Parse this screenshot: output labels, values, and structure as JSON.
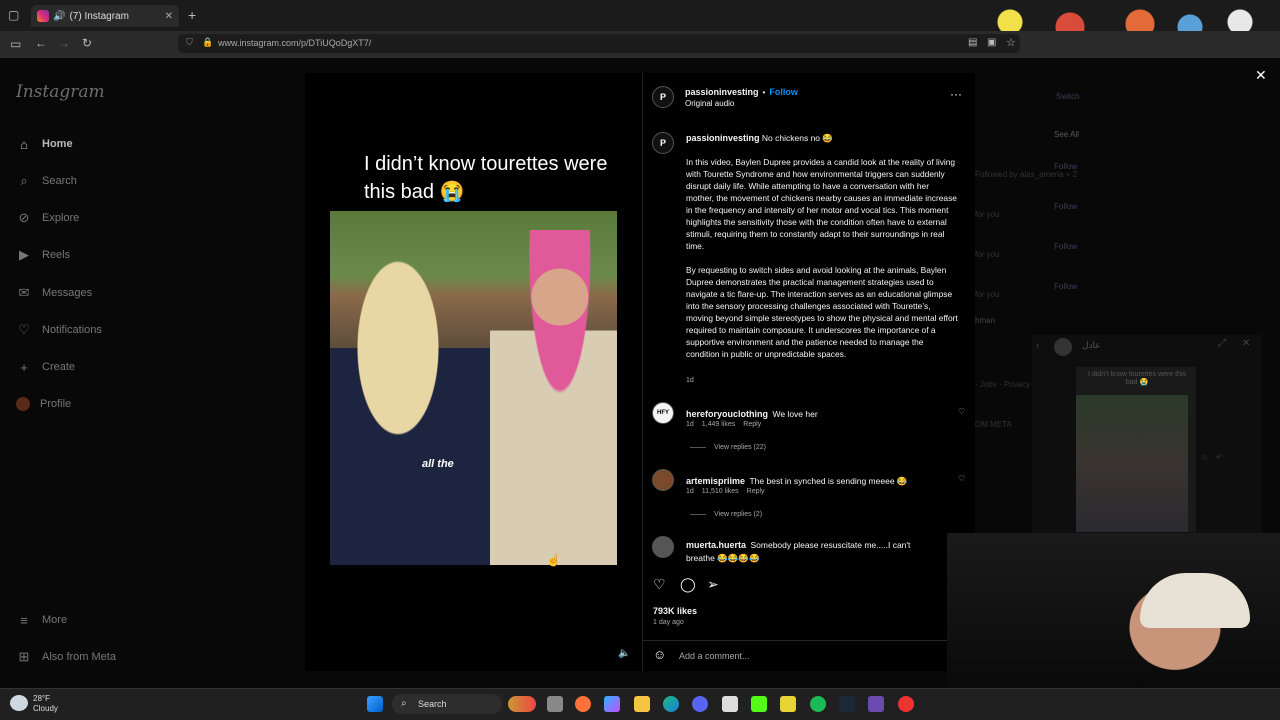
{
  "browser": {
    "tab_title": "(7) Instagram",
    "url": "www.instagram.com/p/DTiUQoDgXT7/"
  },
  "sidebar": {
    "logo": "Instagram",
    "items": [
      {
        "label": "Home",
        "icon": "home-icon"
      },
      {
        "label": "Search",
        "icon": "search-icon"
      },
      {
        "label": "Explore",
        "icon": "compass-icon"
      },
      {
        "label": "Reels",
        "icon": "reels-icon"
      },
      {
        "label": "Messages",
        "icon": "messenger-icon"
      },
      {
        "label": "Notifications",
        "icon": "heart-icon"
      },
      {
        "label": "Create",
        "icon": "plus-icon"
      },
      {
        "label": "Profile",
        "icon": "avatar-icon"
      }
    ],
    "more": "More",
    "also_from_meta": "Also from Meta"
  },
  "video": {
    "caption_text": "I didn’t know tourettes were this bad 😭",
    "subtitle": "all the"
  },
  "post": {
    "author": "passioninvesting",
    "separator": "•",
    "follow": "Follow",
    "audio": "Original audio",
    "caption_user": "passioninvesting",
    "caption_head": "No chickens no 😂",
    "paragraph1": "In this video, Baylen Dupree provides a candid look at the reality of living with Tourette Syndrome and how environmental triggers can suddenly disrupt daily life. While attempting to have a conversation with her mother, the movement of chickens nearby causes an immediate increase in the frequency and intensity of her motor and vocal tics. This moment highlights the sensitivity those with the condition often have to external stimuli, requiring them to constantly adapt to their surroundings in real time.",
    "paragraph2": "By requesting to switch sides and avoid looking at the animals, Baylen Dupree demonstrates the practical management strategies used to navigate a tic flare-up. The interaction serves as an educational glimpse into the sensory processing challenges associated with Tourette’s, moving beyond simple stereotypes to show the physical and mental effort required to maintain composure. It underscores the importance of a supportive environment and the patience needed to manage the condition in public or unpredictable spaces.",
    "caption_age": "1d",
    "comments": [
      {
        "user": "hereforyouclothing",
        "text": "We love her",
        "age": "1d",
        "likes": "1,449 likes",
        "reply": "Reply",
        "view_replies": "View replies (22)"
      },
      {
        "user": "artemispriime",
        "text": "The best in synched is sending meeee 😂",
        "age": "1d",
        "likes": "11,510 likes",
        "reply": "Reply",
        "view_replies": "View replies (2)"
      },
      {
        "user": "muerta.huerta",
        "text": "Somebody please resuscitate me.....I can't breathe 😂😂😂😂"
      }
    ],
    "likes": "793K likes",
    "time": "1 day ago",
    "add_comment_placeholder": "Add a comment..."
  },
  "background_right": {
    "switch": "Switch",
    "see_all": "See All",
    "follow": "Follow",
    "followed_by": "Followed by alas_ameria + 2",
    "for_you": "for you",
    "human": "hman",
    "footer": "· Jobs · Privacy · Terms · Locat",
    "meta": "OM META"
  },
  "mini_player": {
    "title": "عادل",
    "caption": "I didn’t know tourettes were this bad 😭"
  },
  "taskbar": {
    "temp": "28°F",
    "condition": "Cloudy",
    "search": "Search"
  },
  "colors": {
    "follow_blue": "#0095f6",
    "instagram_gradient": "#dd2a7b"
  }
}
